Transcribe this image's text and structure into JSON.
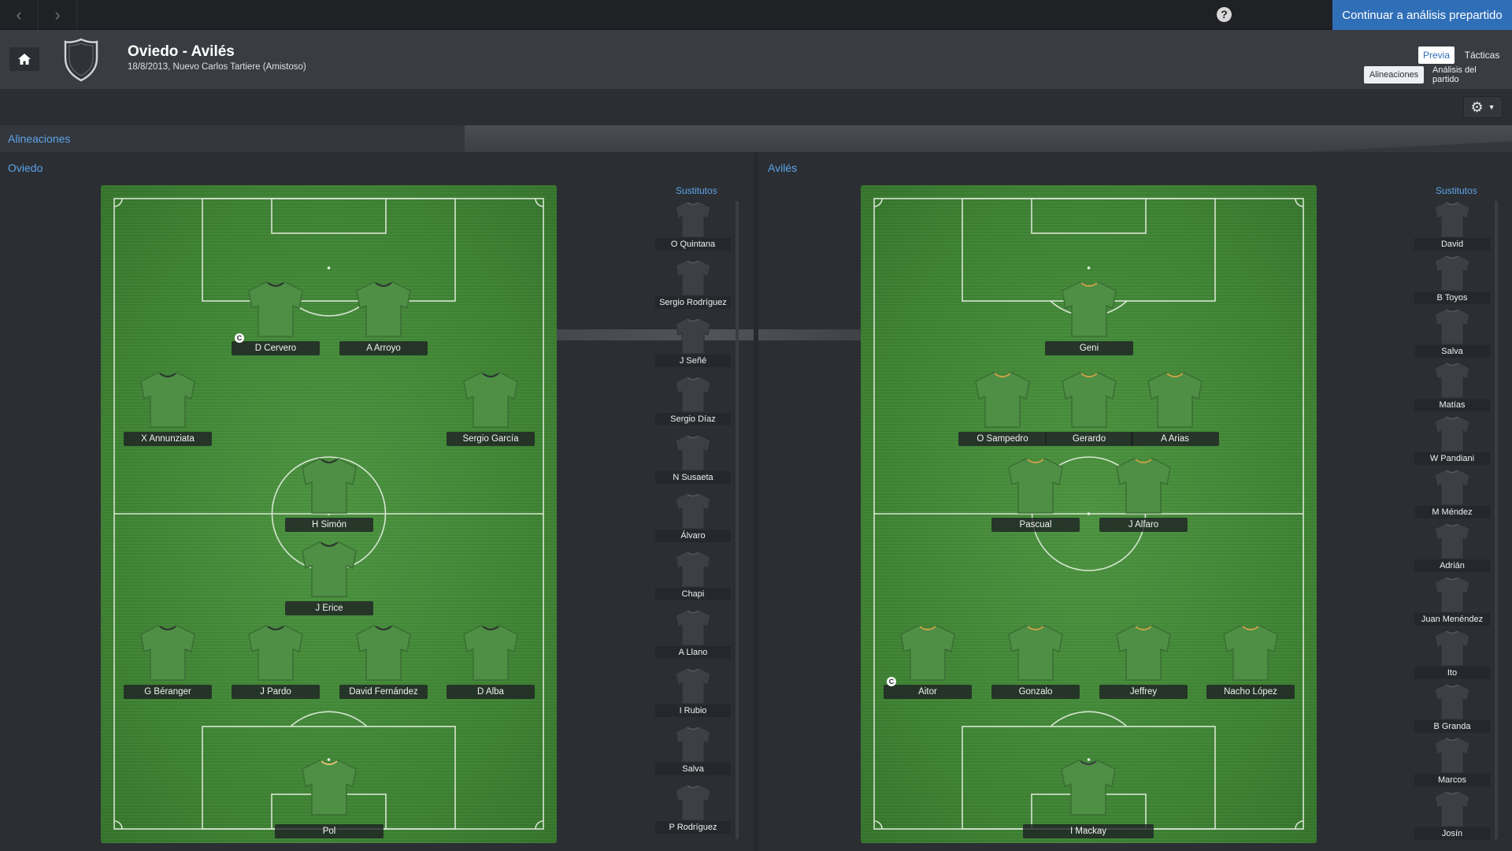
{
  "topbar": {
    "back_icon": "chevron-left-icon",
    "forward_icon": "chevron-right-icon",
    "help_glyph": "?",
    "continue_label": "Continuar a análisis prepartido",
    "accent": "#2f6fb8"
  },
  "header": {
    "title": "Oviedo - Avilés",
    "subtitle": "18/8/2013, Nuevo Carlos Tartiere (Amistoso)",
    "tabs": [
      "Previa",
      "Tácticas"
    ],
    "subtabs": [
      "Alineaciones",
      "Análisis del partido"
    ]
  },
  "section": {
    "title": "Alineaciones"
  },
  "teams": {
    "home": {
      "name": "Oviedo",
      "subs_title": "Sustitutos",
      "players": {
        "p1": "D Cervero",
        "p2": "A Arroyo",
        "p3": "X Annunziata",
        "p4": "Sergio García",
        "p5": "H Simón",
        "p6": "J Erice",
        "p7": "G Béranger",
        "p8": "J Pardo",
        "p9": "David Fernández",
        "p10": "D Alba",
        "p11": "Pol"
      },
      "captain_mark": "C",
      "subs": [
        "O Quintana",
        "Sergio Rodríguez",
        "J Señé",
        "Sergio Díaz",
        "N Susaeta",
        "Álvaro",
        "Chapi",
        "A Llano",
        "I Rubio",
        "Salva",
        "P Rodríguez"
      ]
    },
    "away": {
      "name": "Avilés",
      "subs_title": "Sustitutos",
      "players": {
        "p1": "Geni",
        "p2": "O Sampedro",
        "p3": "Gerardo",
        "p4": "A Arias",
        "p5": "Pascual",
        "p6": "J Alfaro",
        "p7": "Aitor",
        "p8": "Gonzalo",
        "p9": "Jeffrey",
        "p10": "Nacho López",
        "p11": "I Mackay"
      },
      "captain_mark": "C",
      "subs": [
        "David",
        "B Toyos",
        "Salva",
        "Matías",
        "W Pandiani",
        "M Méndez",
        "Adrián",
        "Juan Menéndez",
        "Ito",
        "B Granda",
        "Marcos",
        "Josín"
      ]
    }
  },
  "colors": {
    "background": "#2b2e33",
    "link_blue": "#5da4e8",
    "pitch_green": "#3e8233",
    "shirt_green": "#4e8f45",
    "shirt_grey": "#3c3f44"
  }
}
